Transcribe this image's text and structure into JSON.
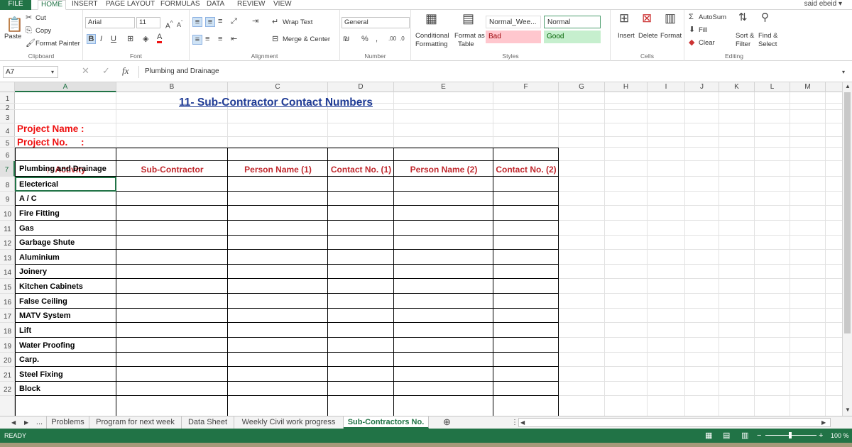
{
  "menu": {
    "file": "FILE",
    "home": "HOME",
    "insert": "INSERT",
    "page_layout": "PAGE LAYOUT",
    "formulas": "FORMULAS",
    "data": "DATA",
    "review": "REVIEW",
    "view": "VIEW"
  },
  "user": "said ebeid",
  "ribbon": {
    "clipboard": {
      "paste": "Paste",
      "cut": "Cut",
      "copy": "Copy",
      "format_painter": "Format Painter",
      "label": "Clipboard"
    },
    "font": {
      "name": "Arial",
      "size": "11",
      "label": "Font"
    },
    "alignment": {
      "wrap": "Wrap Text",
      "merge": "Merge & Center",
      "label": "Alignment"
    },
    "number": {
      "format": "General",
      "label": "Number"
    },
    "styles": {
      "cond1": "Conditional",
      "cond2": "Formatting",
      "fmt1": "Format as",
      "fmt2": "Table",
      "normal_wee": "Normal_Wee...",
      "normal": "Normal",
      "bad": "Bad",
      "good": "Good",
      "label": "Styles"
    },
    "cells": {
      "insert": "Insert",
      "delete": "Delete",
      "format": "Format",
      "label": "Cells"
    },
    "editing": {
      "autosum": "AutoSum",
      "fill": "Fill",
      "clear": "Clear",
      "sort1": "Sort &",
      "sort2": "Filter",
      "find1": "Find &",
      "find2": "Select",
      "label": "Editing"
    }
  },
  "formula_bar": {
    "name_box": "A7",
    "content": "Plumbing and Drainage"
  },
  "columns": [
    "A",
    "B",
    "C",
    "D",
    "E",
    "F",
    "G",
    "H",
    "I",
    "J",
    "K",
    "L",
    "M"
  ],
  "rows": [
    "1",
    "2",
    "3",
    "4",
    "5",
    "6",
    "7",
    "8",
    "9",
    "10",
    "11",
    "12",
    "13",
    "14",
    "15",
    "16",
    "17",
    "18",
    "19",
    "20",
    "21",
    "22"
  ],
  "sheet": {
    "title": "11- Sub-Contractor Contact Numbers",
    "project_name": "Project Name :",
    "project_no": "Project No.     :",
    "headers": [
      "Activity",
      "Sub-Contractor",
      "Person Name (1)",
      "Contact No. (1)",
      "Person Name (2)",
      "Contact No. (2)"
    ],
    "header_prefix": "⚲⚲",
    "activities": [
      "Plumbing and Drainage",
      "Electerical",
      "A / C",
      "Fire Fitting",
      "Gas",
      "Garbage Shute",
      "Aluminium",
      "Joinery",
      "Kitchen Cabinets",
      "False Ceiling",
      "MATV System",
      "Lift",
      "Water Proofing",
      "Carp.",
      "Steel Fixing",
      "Block"
    ]
  },
  "sheet_tabs": [
    "...",
    "Problems",
    "Program for next week",
    "Data Sheet",
    "Weekly Civil work progress",
    "Sub-Contractors No."
  ],
  "active_tab": "Sub-Contractors No.",
  "status": {
    "ready": "READY",
    "zoom": "100 %"
  }
}
